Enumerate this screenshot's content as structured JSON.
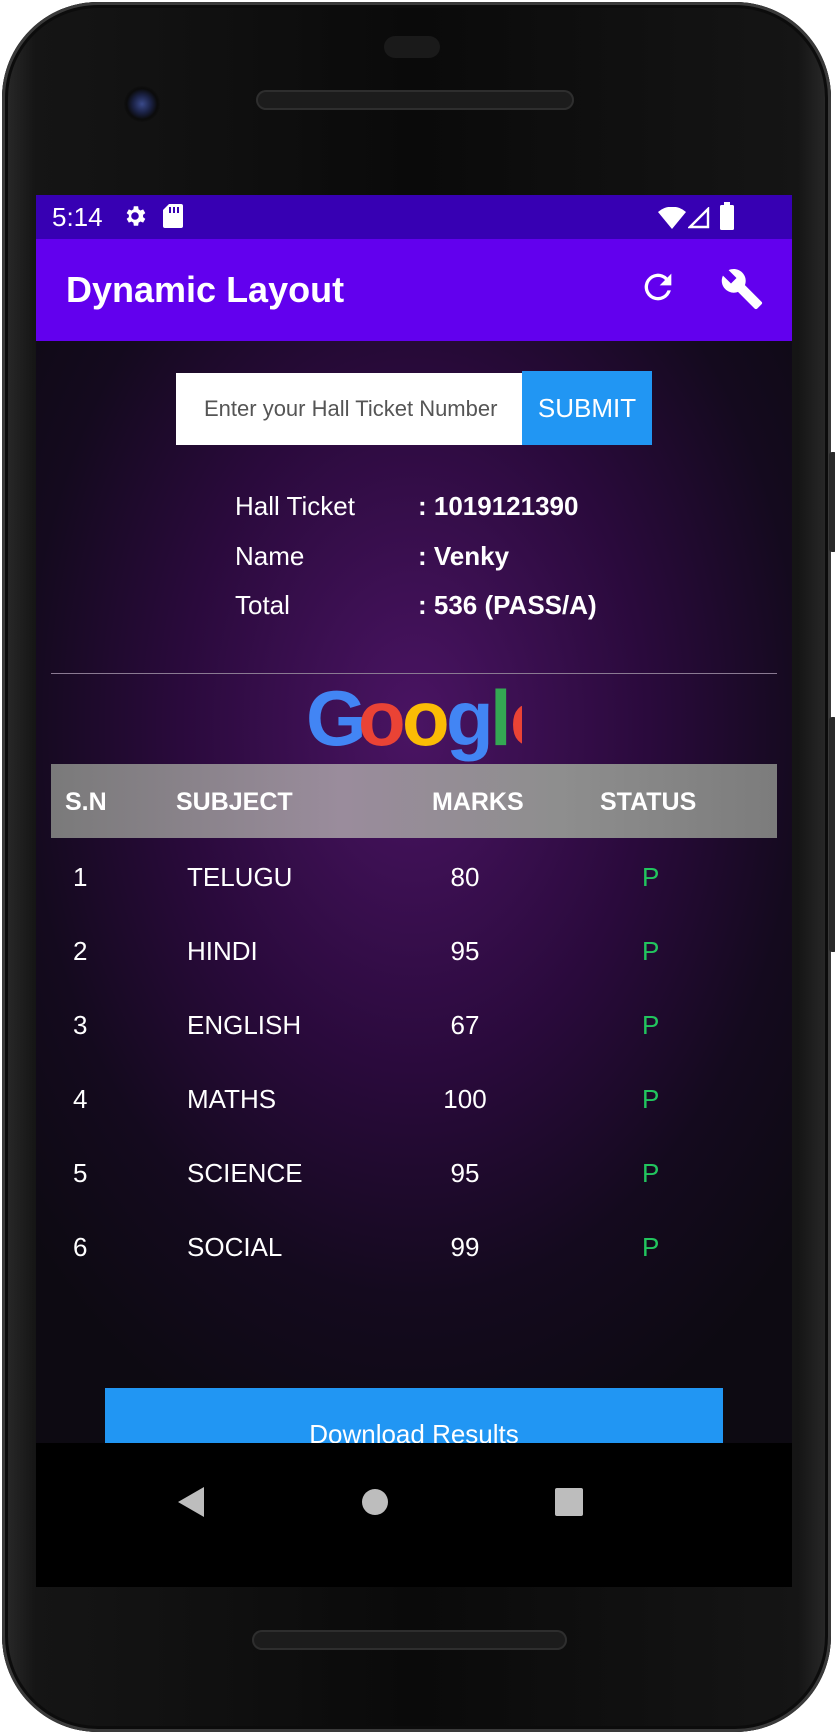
{
  "status_bar": {
    "time": "5:14"
  },
  "app_bar": {
    "title": "Dynamic Layout"
  },
  "search": {
    "placeholder": "Enter your Hall Ticket Number",
    "submit_label": "SUBMIT"
  },
  "student": {
    "rows": [
      {
        "label": "Hall Ticket",
        "value": ": 1019121390"
      },
      {
        "label": "Name",
        "value": ": Venky"
      },
      {
        "label": "Total",
        "value": ": 536 (PASS/A)"
      }
    ]
  },
  "logo": {
    "letters": [
      "G",
      "o",
      "o",
      "g",
      "l",
      "e"
    ],
    "colors": [
      "#4285f4",
      "#ea4335",
      "#fbbc05",
      "#4285f4",
      "#34a853",
      "#ea4335"
    ]
  },
  "table": {
    "headers": [
      "S.N",
      "SUBJECT",
      "MARKS",
      "STATUS"
    ],
    "rows": [
      {
        "sn": "1",
        "subject": "TELUGU",
        "marks": "80",
        "status": "P"
      },
      {
        "sn": "2",
        "subject": "HINDI",
        "marks": "95",
        "status": "P"
      },
      {
        "sn": "3",
        "subject": "ENGLISH",
        "marks": "67",
        "status": "P"
      },
      {
        "sn": "4",
        "subject": "MATHS",
        "marks": "100",
        "status": "P"
      },
      {
        "sn": "5",
        "subject": "SCIENCE",
        "marks": "95",
        "status": "P"
      },
      {
        "sn": "6",
        "subject": "SOCIAL",
        "marks": "99",
        "status": "P"
      }
    ]
  },
  "download": {
    "label": "Download Results"
  },
  "colors": {
    "status_bar": "#3700b3",
    "app_bar": "#6200ee",
    "accent": "#2196f3",
    "pass": "#22c55e"
  },
  "icons": {
    "status_left": [
      "gear-icon",
      "sd-card-icon"
    ],
    "status_right": [
      "wifi-icon",
      "signal-icon",
      "battery-icon"
    ],
    "app_bar": [
      "refresh-icon",
      "wrench-icon"
    ],
    "nav": [
      "back-icon",
      "home-icon",
      "recents-icon"
    ]
  }
}
